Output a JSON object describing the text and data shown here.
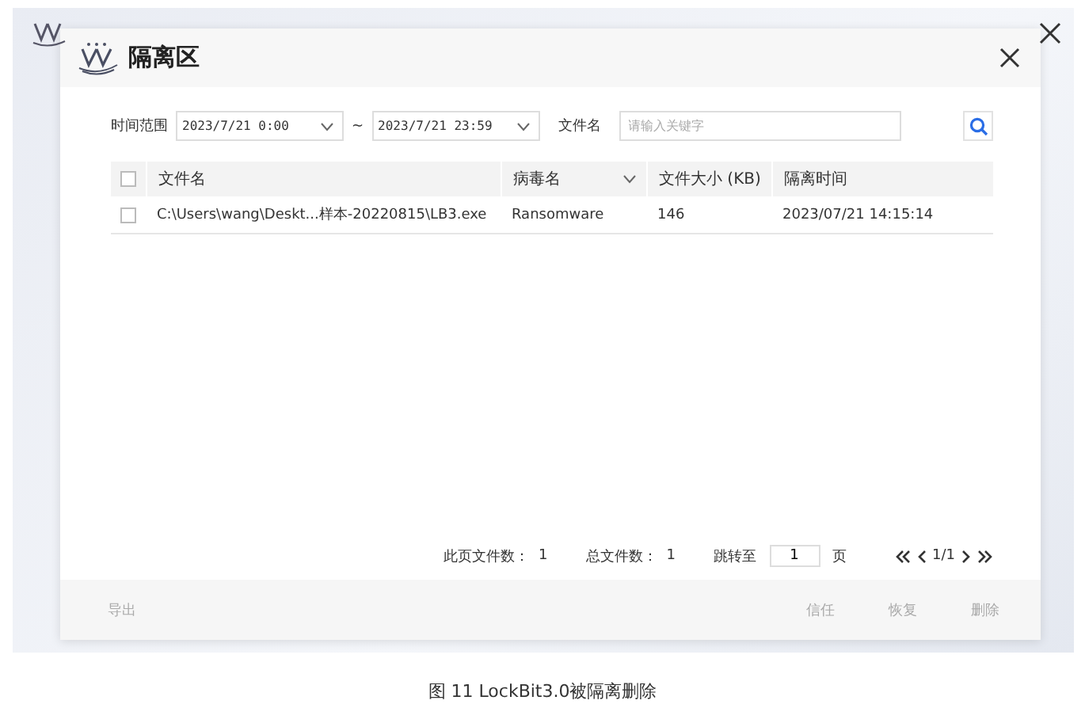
{
  "dialog": {
    "title": "隔离区"
  },
  "filters": {
    "time_label": "时间范围",
    "start": "2023/7/21 0:00",
    "separator": "~",
    "end": "2023/7/21 23:59",
    "name_label": "文件名",
    "name_placeholder": "请输入关键字"
  },
  "table": {
    "all_checked": false,
    "columns": [
      {
        "label": "文件名",
        "kind": "plain"
      },
      {
        "label": "病毒名",
        "kind": "dropdown"
      },
      {
        "label": "文件大小 (KB)",
        "kind": "plain"
      },
      {
        "label": "隔离时间",
        "kind": "plain"
      }
    ],
    "rows": [
      {
        "checked": false,
        "cells": [
          "C:\\Users\\wang\\Deskt...样本-20220815\\LB3.exe",
          "Ransomware",
          "146",
          "2023/07/21 14:15:14"
        ]
      }
    ]
  },
  "pagination": {
    "page_count_label": "此页文件数：",
    "page_count": "1",
    "total_label": "总文件数：",
    "total": "1",
    "jump_label": "跳转至",
    "jump_value": "1",
    "page_unit": "页",
    "pages": "1/1"
  },
  "footer": {
    "left": [
      {
        "label": "导出",
        "disabled": true
      }
    ],
    "right": [
      {
        "label": "信任",
        "disabled": true
      },
      {
        "label": "恢复",
        "disabled": true
      },
      {
        "label": "删除",
        "disabled": true
      }
    ]
  },
  "caption": "图 11 LockBit3.0被隔离删除"
}
